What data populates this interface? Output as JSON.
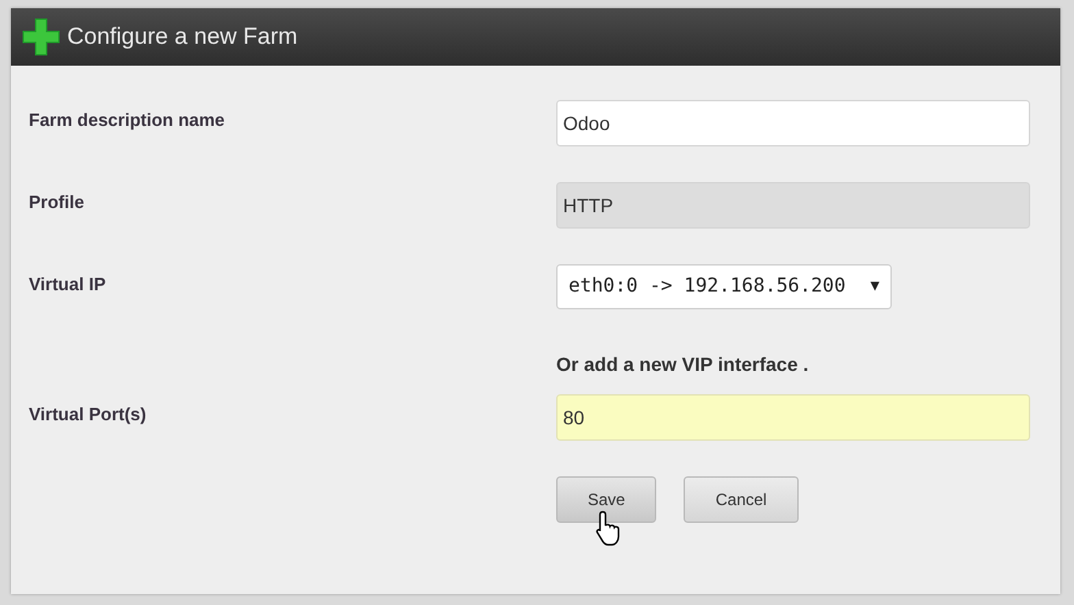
{
  "panel": {
    "title": "Configure a new Farm"
  },
  "fields": [
    {
      "label": "Farm description name",
      "kind": "text",
      "value": "Odoo"
    },
    {
      "label": "Profile",
      "kind": "readonly",
      "value": "HTTP"
    },
    {
      "label": "Virtual IP",
      "kind": "select",
      "value": "eth0:0 -> 192.168.56.200",
      "arrow": "▼"
    },
    {
      "kind": "note",
      "text": "Or add a new VIP interface ."
    },
    {
      "label": "Virtual Port(s)",
      "kind": "highlighted",
      "value": "80"
    }
  ],
  "buttons": [
    {
      "label": "Save",
      "hovered": true
    },
    {
      "label": "Cancel",
      "hovered": false
    }
  ]
}
